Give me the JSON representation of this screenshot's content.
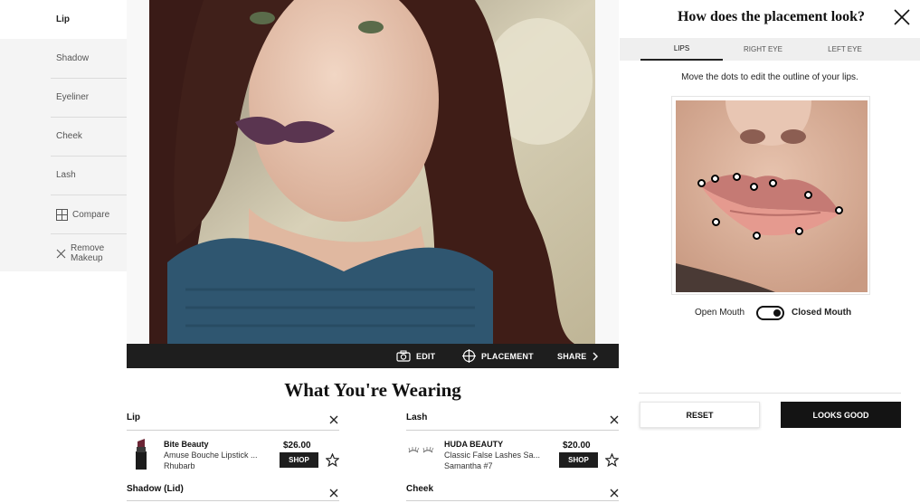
{
  "menu": {
    "items": [
      {
        "label": "Lip"
      },
      {
        "label": "Shadow"
      },
      {
        "label": "Eyeliner"
      },
      {
        "label": "Cheek"
      },
      {
        "label": "Lash"
      }
    ],
    "compare_label": "Compare",
    "remove_label": "Remove\nMakeup"
  },
  "toolbar": {
    "edit_label": "EDIT",
    "placement_label": "PLACEMENT",
    "share_label": "SHARE"
  },
  "wearing": {
    "title": "What You're Wearing",
    "sections": [
      {
        "name": "Lip",
        "brand": "Bite Beauty",
        "product": "Amuse Bouche Lipstick ...",
        "shade": "Rhubarb",
        "price": "$26.00",
        "shop_label": "SHOP"
      },
      {
        "name": "Lash",
        "brand": "HUDA BEAUTY",
        "product": "Classic False Lashes Sa...",
        "shade": "Samantha #7",
        "price": "$20.00",
        "shop_label": "SHOP"
      },
      {
        "name": "Shadow (Lid)"
      },
      {
        "name": "Cheek"
      }
    ]
  },
  "panel": {
    "title": "How does the placement look?",
    "tabs": [
      {
        "label": "LIPS"
      },
      {
        "label": "RIGHT EYE"
      },
      {
        "label": "LEFT EYE"
      }
    ],
    "instruction": "Move the dots to edit the outline of your lips.",
    "toggle_left": "Open Mouth",
    "toggle_right": "Closed Mouth",
    "reset_label": "RESET",
    "good_label": "LOOKS GOOD"
  },
  "colors": {
    "accent": "#1e1e1e",
    "lip_shade": "#5a3550"
  }
}
